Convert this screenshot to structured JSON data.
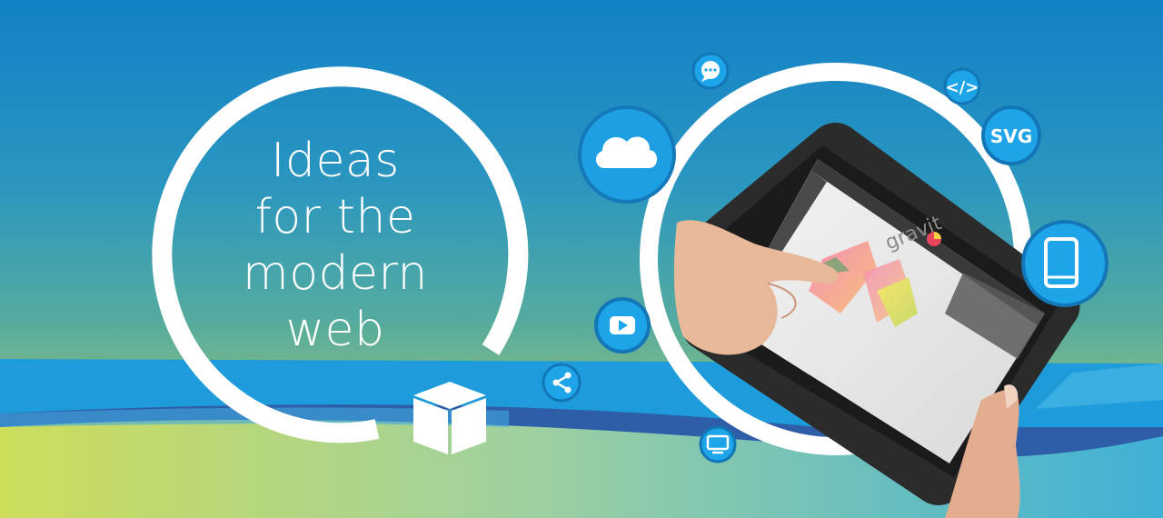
{
  "banner": {
    "headline_lines": [
      "Ideas",
      "for the",
      "modern",
      "web"
    ]
  },
  "tablet": {
    "screen_logo_text": "gravit"
  },
  "icons": {
    "code_label": "</>",
    "svg_label": "SVG"
  },
  "colors": {
    "sky_top": "#1284c7",
    "sky_mid": "#2e9ab8",
    "horizon": "#84bd83",
    "water": "#1c9ad9",
    "water_dark": "#2f5aa6",
    "foreground": "#c9dd60",
    "icon_blue": "#1da4e8",
    "ring": "#ffffff"
  }
}
